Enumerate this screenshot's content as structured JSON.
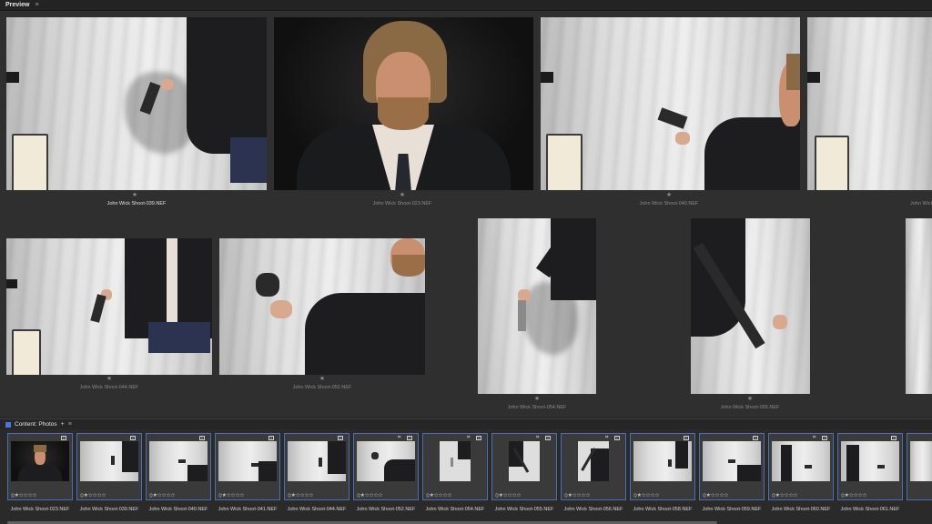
{
  "preview": {
    "title": "Preview",
    "menu_icon": "hamburger-menu-icon",
    "photos": [
      {
        "caption": "John Wick Shoot-039.NEF",
        "selected": true
      },
      {
        "caption": "John Wick Shoot-023.NEF",
        "selected": false
      },
      {
        "caption": "John Wick Shoot-040.NEF",
        "selected": false
      },
      {
        "caption": "John Wick Shoot-041.NEF",
        "selected": false
      },
      {
        "caption": "John Wick Shoot-044.NEF",
        "selected": false
      },
      {
        "caption": "John Wick Shoot-052.NEF",
        "selected": false
      },
      {
        "caption": "John Wick Shoot-054.NEF",
        "selected": false
      },
      {
        "caption": "John Wick Shoot-055.NEF",
        "selected": false
      }
    ],
    "star": "★"
  },
  "content": {
    "title": "Content: Photos",
    "add_label": "+",
    "menu_icon": "hamburger-menu-icon",
    "accent_color": "#3f7bd8",
    "thumbnails": [
      {
        "name": "John Wick Shoot-023.NEF",
        "rating": "⦸★☆☆☆☆"
      },
      {
        "name": "John Wick Shoot-039.NEF",
        "rating": "⦸★☆☆☆☆"
      },
      {
        "name": "John Wick Shoot-040.NEF",
        "rating": "⦸★☆☆☆☆"
      },
      {
        "name": "John Wick Shoot-041.NEF",
        "rating": "⦸★☆☆☆☆"
      },
      {
        "name": "John Wick Shoot-044.NEF",
        "rating": "⦸★☆☆☆☆"
      },
      {
        "name": "John Wick Shoot-052.NEF",
        "rating": "⦸★☆☆☆☆"
      },
      {
        "name": "John Wick Shoot-054.NEF",
        "rating": "⦸★☆☆☆☆"
      },
      {
        "name": "John Wick Shoot-055.NEF",
        "rating": "⦸★☆☆☆☆"
      },
      {
        "name": "John Wick Shoot-056.NEF",
        "rating": "⦸★☆☆☆☆"
      },
      {
        "name": "John Wick Shoot-058.NEF",
        "rating": "⦸★☆☆☆☆"
      },
      {
        "name": "John Wick Shoot-059.NEF",
        "rating": "⦸★☆☆☆☆"
      },
      {
        "name": "John Wick Shoot-060.NEF",
        "rating": "⦸★☆☆☆☆"
      },
      {
        "name": "John Wick Shoot-061.NEF",
        "rating": "⦸★☆☆☆☆"
      }
    ]
  }
}
